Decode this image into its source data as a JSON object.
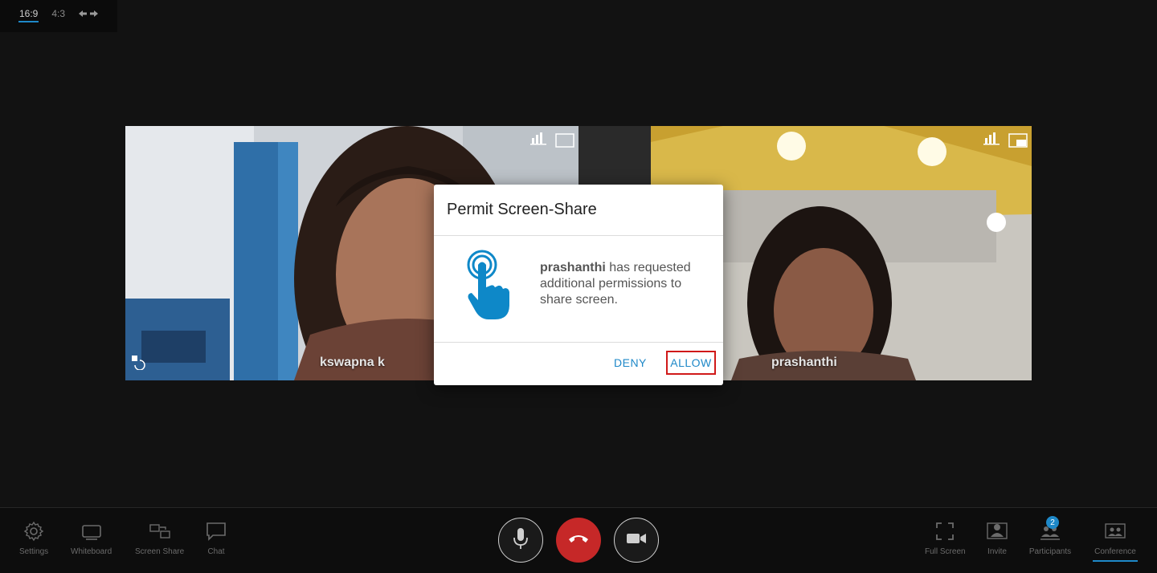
{
  "aspect": {
    "options": [
      "16:9",
      "4:3"
    ],
    "active": "16:9"
  },
  "participants": [
    {
      "name": "kswapna k"
    },
    {
      "name": "prashanthi"
    }
  ],
  "dialog": {
    "title": "Permit Screen-Share",
    "requester": "prashanthi",
    "message": " has requested additional permissions to share screen.",
    "deny_label": "DENY",
    "allow_label": "ALLOW"
  },
  "toolbar": {
    "left": [
      {
        "label": "Settings",
        "icon": "gear-icon"
      },
      {
        "label": "Whiteboard",
        "icon": "whiteboard-icon"
      },
      {
        "label": "Screen Share",
        "icon": "screen-share-icon"
      },
      {
        "label": "Chat",
        "icon": "chat-icon"
      }
    ],
    "right": [
      {
        "label": "Full Screen",
        "icon": "fullscreen-icon"
      },
      {
        "label": "Invite",
        "icon": "invite-icon"
      },
      {
        "label": "Participants",
        "icon": "participants-icon",
        "badge": "2"
      },
      {
        "label": "Conference",
        "icon": "conference-icon"
      }
    ]
  },
  "colors": {
    "accent": "#1e88c8",
    "end_call": "#c62828",
    "highlight": "#d01919"
  }
}
